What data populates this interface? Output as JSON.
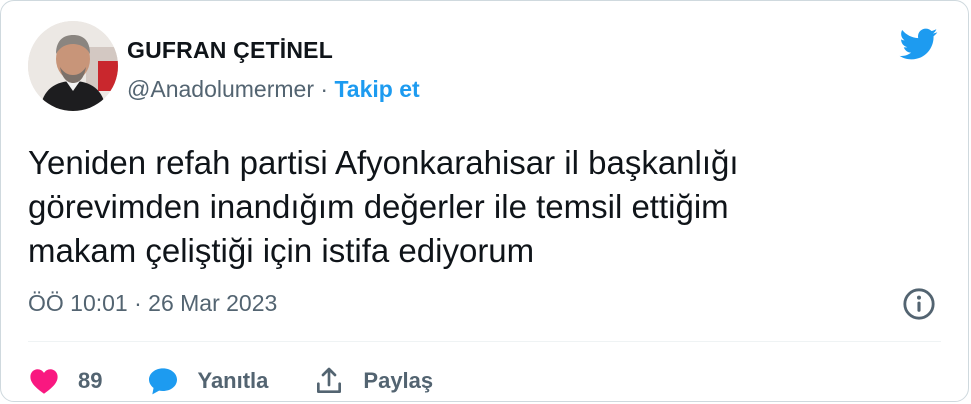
{
  "author": {
    "name": "GUFRAN ÇETİNEL",
    "handle": "@Anadolumermer",
    "separator": "·",
    "follow_label": "Takip et"
  },
  "tweet": {
    "lines": [
      "Yeniden refah partisi Afyonkarahisar il başkanlığı",
      "görevimden inandığım değerler ile temsil ettiğim",
      "makam çeliştiği için istifa ediyorum"
    ],
    "timestamp": "ÖÖ 10:01 · 26 Mar 2023"
  },
  "actions": {
    "like_count": "89",
    "reply_label": "Yanıtla",
    "share_label": "Paylaş"
  },
  "colors": {
    "accent": "#1d9bf0",
    "like": "#f91880",
    "muted": "#536471",
    "text": "#0f1419"
  },
  "icons": {
    "brand": "twitter-bird-icon",
    "info": "info-icon",
    "like": "heart-icon",
    "reply": "speech-bubble-icon",
    "share": "share-arrow-icon"
  }
}
